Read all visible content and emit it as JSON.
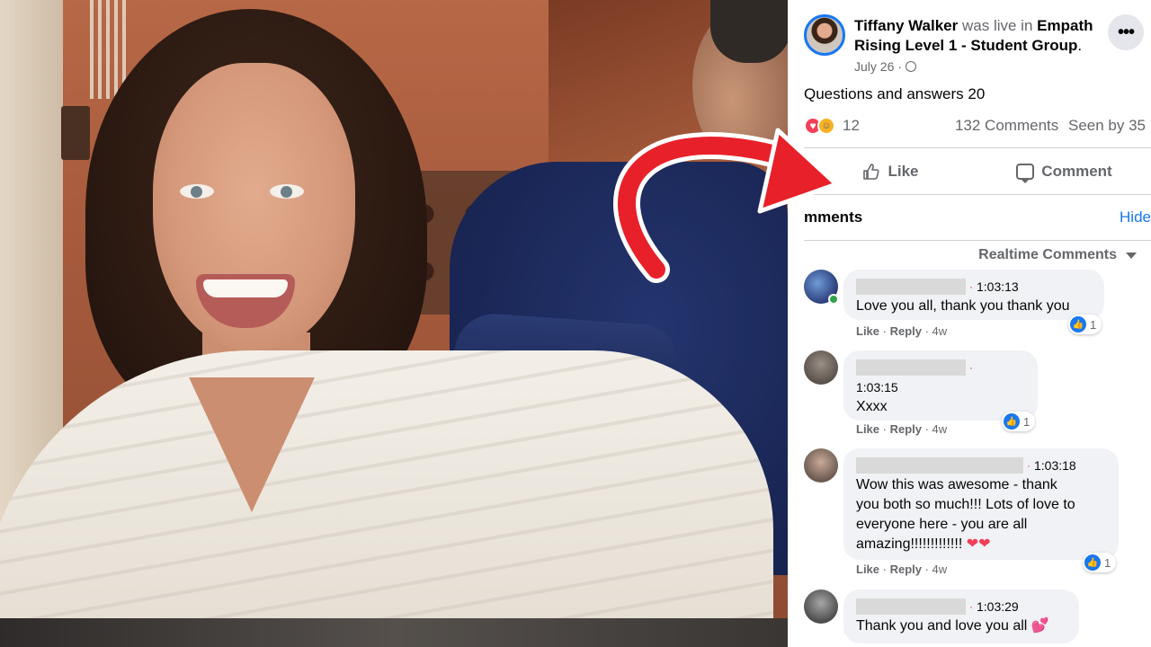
{
  "post": {
    "author": "Tiffany Walker",
    "was_live_in": "was live in",
    "group": "Empath Rising Level 1 - Student Group",
    "period": ".",
    "date": "July 26",
    "more_icon": "more-icon",
    "text": "Questions and answers 20",
    "reaction_count": "12",
    "comments_count": "132 Comments",
    "seen_by": "Seen by 35"
  },
  "actions": {
    "like": "Like",
    "comment": "Comment"
  },
  "comments_section": {
    "title": "mments",
    "hide": "Hide",
    "sort_label": "Realtime Comments"
  },
  "comments": [
    {
      "time": "1:03:13",
      "text": "Love you all, thank you thank you",
      "like": "Like",
      "reply": "Reply",
      "age": "4w",
      "likes": "1"
    },
    {
      "time": "1:03:15",
      "text": "Xxxx",
      "like": "Like",
      "reply": "Reply",
      "age": "4w",
      "likes": "1"
    },
    {
      "time": "1:03:18",
      "text_lines": [
        "Wow this was awesome - thank",
        "you both so much!!! Lots of love to",
        "everyone here - you are all",
        "amazing!!!!!!!!!!!!!"
      ],
      "hearts": "❤❤",
      "like": "Like",
      "reply": "Reply",
      "age": "4w",
      "likes": "1"
    },
    {
      "time": "1:03:29",
      "text": "Thank you and love you all",
      "emoji": "💕"
    }
  ],
  "colors": {
    "facebook_blue": "#1877f2",
    "arrow_red": "#e8202a",
    "online_green": "#31a24c"
  }
}
